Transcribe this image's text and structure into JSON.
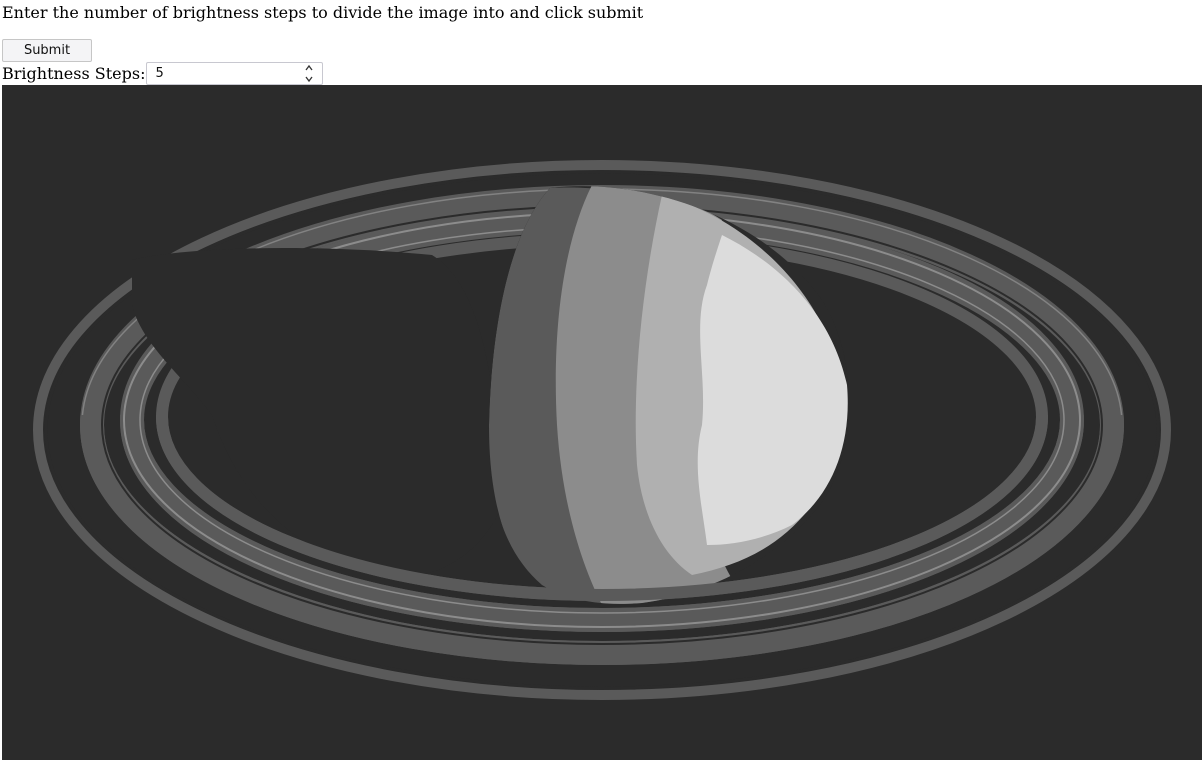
{
  "instruction": "Enter the number of brightness steps to divide the image into and click submit",
  "submit_label": "Submit",
  "steps": {
    "label": "Brightness Steps:",
    "value": "5"
  },
  "image": {
    "subject": "saturn-posterized",
    "palette": [
      "#2b2b2b",
      "#5a5a5a",
      "#8c8c8c",
      "#b0b0b0",
      "#dcdcdc"
    ]
  }
}
